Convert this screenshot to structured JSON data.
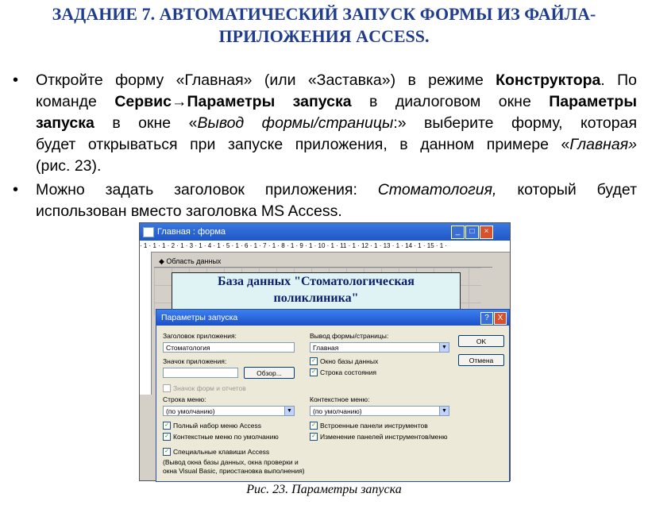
{
  "heading": {
    "line1": "ЗАДАНИЕ 7. АВТОМАТИЧЕСКИЙ ЗАПУСК ФОРМЫ ИЗ ФАЙЛА-",
    "line2": "ПРИЛОЖЕНИЯ ACCESS."
  },
  "bullet1": {
    "l1a": "Откройте форму «Главная» (или «Заставка») в режиме ",
    "l1b": "Конструктора",
    "l1c": ". По",
    "l2a": "команде ",
    "l2b": "Сервис→Параметры запуска",
    "l2c": " в диалоговом окне ",
    "l2d": "Параметры",
    "l3a": "запуска",
    "l3b": " в окне «",
    "l3c": "Вывод формы/страницы",
    "l3d": ":» выберите форму, которая",
    "l4a": "будет открываться при запуске приложения, в данном примере «",
    "l4b": "Главная»",
    "l5": "(рис. 23)."
  },
  "bullet2": {
    "l1a": "Можно задать заголовок приложения: ",
    "l1b": "Стоматология,",
    "l1c": " который будет",
    "l2": "использован вместо заголовка MS Access."
  },
  "form_window": {
    "title": "Главная : форма",
    "ruler": "· 1 · 1 · 1 · 2 · 1 · 3 · 1 · 4 · 1 · 5 · 1 · 6 · 1 · 7 · 1 · 8 · 1 · 9 · 1 · 10 · 1 · 11 · 1 · 12 · 1 · 13 · 1 · 14 · 1 · 15 · 1 ·",
    "section": "◆ Область данных",
    "label_line1": "База данных \"Стоматологическая",
    "label_line2": "поликлиника\""
  },
  "dialog": {
    "title": "Параметры запуска",
    "app_title_label": "Заголовок приложения:",
    "app_title_value": "Стоматология",
    "app_icon_label": "Значок приложения:",
    "browse_btn": "Обзор...",
    "icon_forms": "Значок форм и отчетов",
    "menu_label": "Строка меню:",
    "menu_value": "(по умолчанию)",
    "full_menus": "Полный набор меню Access",
    "context_default": "Контекстные меню по умолчанию",
    "special_keys": "Специальные клавиши Access",
    "note1": "(Вывод окна базы данных, окна проверки и",
    "note2": "окна Visual Basic, приостановка выполнения)",
    "display_form_label": "Вывод формы/страницы:",
    "display_form_value": "Главная",
    "db_window": "Окно базы данных",
    "status_bar": "Строка состояния",
    "context_menu_label": "Контекстное меню:",
    "context_menu_value": "(по умолчанию)",
    "builtin_toolbars": "Встроенные панели инструментов",
    "toolbar_changes": "Изменение панелей инструментов/меню",
    "ok": "OK",
    "cancel": "Отмена",
    "help_icon": "?",
    "close_icon": "X"
  },
  "caption": "Рис. 23. Параметры запуска"
}
